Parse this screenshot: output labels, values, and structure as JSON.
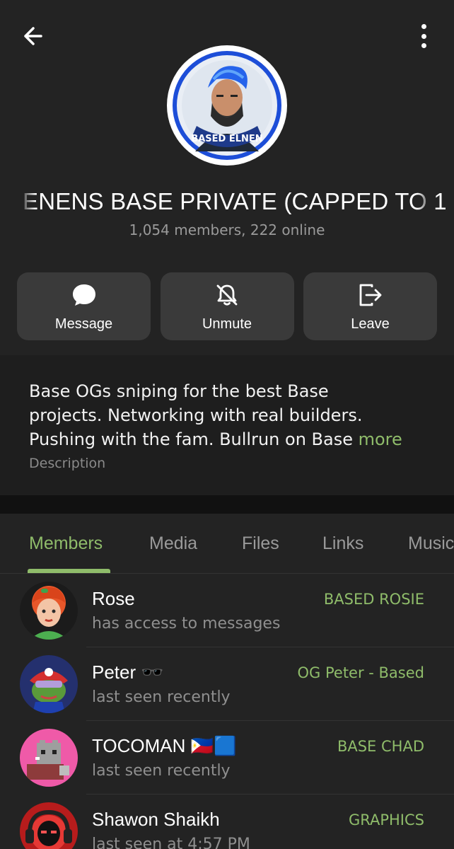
{
  "header": {
    "avatar_text": "BASED ELNEN",
    "title": "ENENS BASE PRIVATE (CAPPED TO 1",
    "subtitle": "1,054 members, 222 online"
  },
  "actions": [
    {
      "label": "Message",
      "icon": "chat-bubble-icon"
    },
    {
      "label": "Unmute",
      "icon": "bell-off-icon"
    },
    {
      "label": "Leave",
      "icon": "exit-icon"
    }
  ],
  "description": {
    "lines": [
      "Base OGs sniping for the best Base",
      "projects. Networking with real builders.",
      "Pushing with the fam. Bullrun on Base"
    ],
    "more": "more",
    "label": "Description"
  },
  "tabs": [
    "Members",
    "Media",
    "Files",
    "Links",
    "Music"
  ],
  "active_tab": "Members",
  "members": [
    {
      "name": "Rose",
      "status": "has access to messages",
      "role": "BASED ROSIE"
    },
    {
      "name": "Peter 🕶️",
      "status": "last seen recently",
      "role": "OG Peter - Based"
    },
    {
      "name": "TOCOMAN 🇵🇭🟦",
      "status": "last seen recently",
      "role": "BASE CHAD"
    },
    {
      "name": "Shawon Shaikh",
      "status": "last seen at 4:57 PM",
      "role": "GRAPHICS"
    }
  ],
  "colors": {
    "accent": "#8fbc6a",
    "background": "#232323",
    "button": "#3a3a3a"
  }
}
